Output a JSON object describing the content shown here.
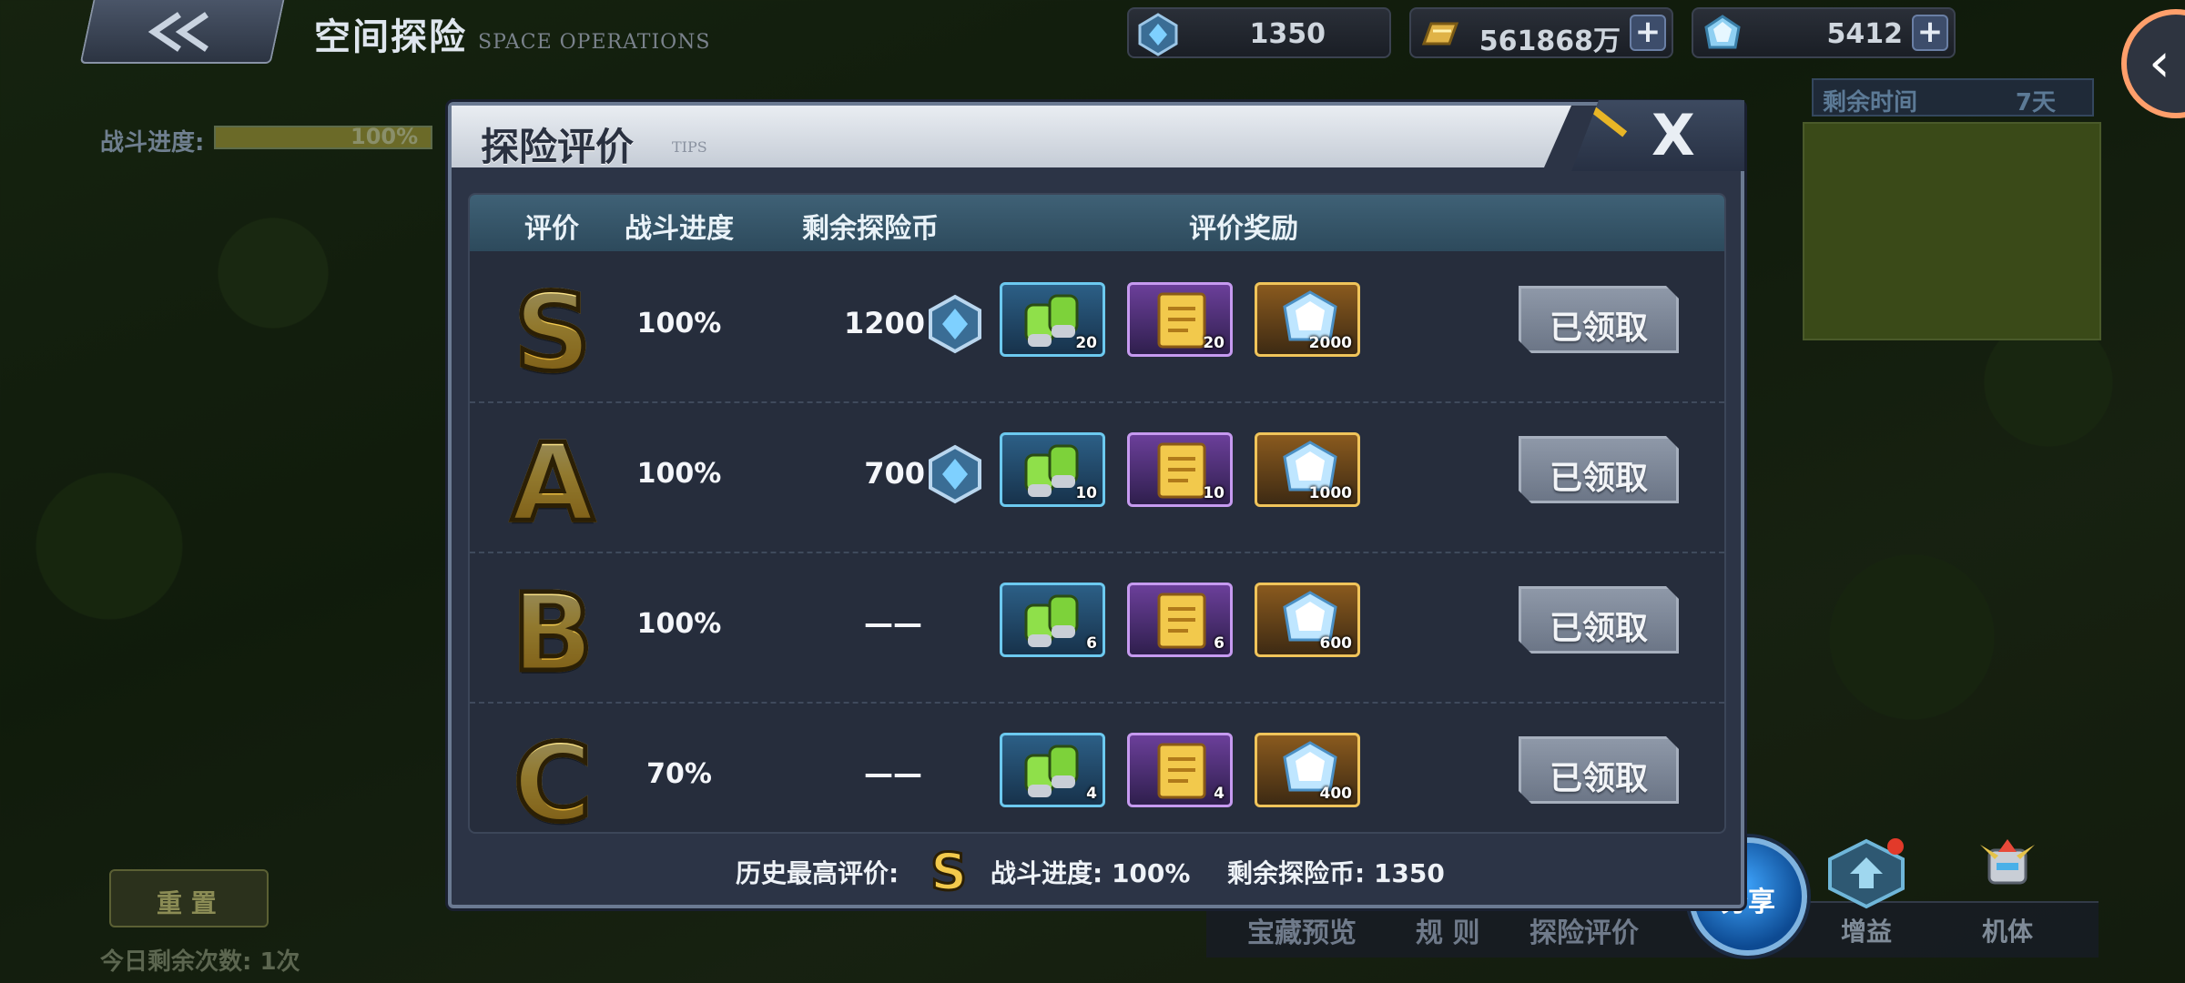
{
  "header": {
    "title": "空间探险",
    "subtitle": "SPACE OPERATIONS",
    "resources": [
      {
        "name": "exploration-coin",
        "value": "1350",
        "color": "#46a3e6"
      },
      {
        "name": "gold",
        "value": "561868万",
        "color": "#e0b347"
      },
      {
        "name": "crystal",
        "value": "5412",
        "color": "#8fd0f2"
      }
    ]
  },
  "background": {
    "battle_progress_label": "战斗进度:",
    "battle_progress_value": "100%",
    "remaining_time_label": "剩余时间",
    "remaining_time_value": "7天",
    "left_button_label": "重 置",
    "daily_remaining": "今日剩余次数: 1次",
    "bottom_tabs": [
      "宝藏预览",
      "规 则",
      "探险评价"
    ],
    "share_label": "分享",
    "boost_label": "增益",
    "mech_label": "机体"
  },
  "modal": {
    "title": "探险评价",
    "title_tip": "TIPS",
    "close_label": "X",
    "columns": [
      "评价",
      "战斗进度",
      "剩余探险币",
      "评价奖励"
    ],
    "rows": [
      {
        "grade": "S",
        "progress": "100%",
        "coins": "1200",
        "show_coin_icon": true,
        "rewards": [
          "20",
          "20",
          "2000"
        ],
        "claim_label": "已领取"
      },
      {
        "grade": "A",
        "progress": "100%",
        "coins": "700",
        "show_coin_icon": true,
        "rewards": [
          "10",
          "10",
          "1000"
        ],
        "claim_label": "已领取"
      },
      {
        "grade": "B",
        "progress": "100%",
        "coins": "——",
        "show_coin_icon": false,
        "rewards": [
          "6",
          "6",
          "600"
        ],
        "claim_label": "已领取"
      },
      {
        "grade": "C",
        "progress": "70%",
        "coins": "——",
        "show_coin_icon": false,
        "rewards": [
          "4",
          "4",
          "400"
        ],
        "claim_label": "已领取"
      }
    ],
    "footer": {
      "best_label": "历史最高评价:",
      "best_grade": "S",
      "progress_text": "战斗进度: 100%",
      "coins_text": "剩余探险币: 1350"
    }
  },
  "colors": {
    "accent_gold": "#f2c94c",
    "panel_bg": "#2c3446",
    "table_header": "#3f6176",
    "claimed_button": "#8e98a8"
  }
}
